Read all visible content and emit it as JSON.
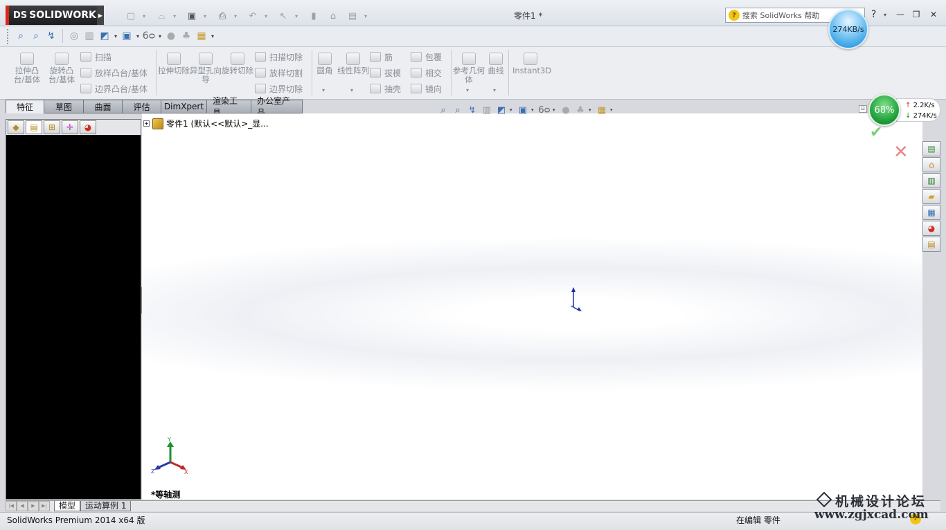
{
  "titlebar": {
    "logo_text": "SOLIDWORKS",
    "logo_ds": "DS",
    "document_title": "零件1 *",
    "search_placeholder": "搜索 SolidWorks 帮助",
    "help_glyph": "?",
    "speed_bubble": "274KB/s"
  },
  "command_manager": {
    "extrude_boss": "拉伸凸台/基体",
    "revolve_boss": "旋转凸台/基体",
    "sweep": "扫描",
    "loft": "放样凸台/基体",
    "boundary": "边界凸台/基体",
    "extrude_cut": "拉伸切除",
    "hole_wizard": "异型孔向导",
    "revolve_cut": "旋转切除",
    "swept_cut": "扫描切除",
    "lofted_cut": "放样切割",
    "boundary_cut": "边界切除",
    "fillet": "圆角",
    "linear_pattern": "线性阵列",
    "rib": "筋",
    "draft": "拔模",
    "shell": "抽壳",
    "wrap": "包覆",
    "intersect": "相交",
    "mirror": "镜向",
    "ref_geometry": "参考几何体",
    "curves": "曲线",
    "instant3d": "Instant3D"
  },
  "tabs": [
    {
      "label": "特征",
      "active": true
    },
    {
      "label": "草图"
    },
    {
      "label": "曲面"
    },
    {
      "label": "评估"
    },
    {
      "label": "DimXpert"
    },
    {
      "label": "渲染工具"
    },
    {
      "label": "办公室产品"
    }
  ],
  "feature_tree": {
    "root_label": "零件1 (默认<<默认>_显..."
  },
  "graphics": {
    "view_label": "*等轴测",
    "triad": {
      "x": "X",
      "y": "Y",
      "z": "Z"
    }
  },
  "net_meter": {
    "percent": "68%",
    "upload": "2.2K/s",
    "download": "274K/s"
  },
  "bottom_tabs": [
    {
      "label": "模型",
      "active": true
    },
    {
      "label": "运动算例 1"
    }
  ],
  "statusbar": {
    "product": "SolidWorks Premium 2014 x64 版",
    "mode": "在编辑 零件"
  },
  "watermark": {
    "title": "机械设计论坛",
    "url": "www.zgjxcad.com"
  }
}
